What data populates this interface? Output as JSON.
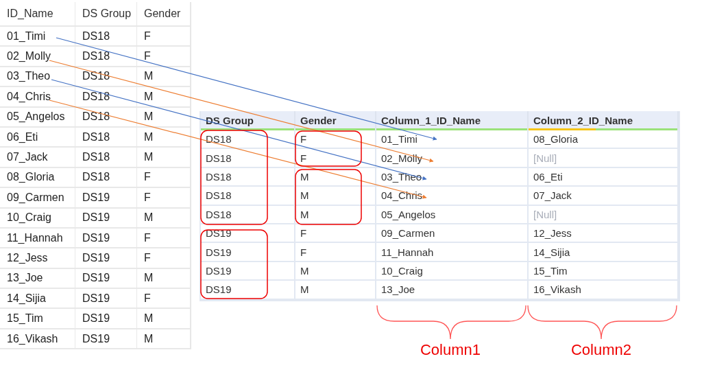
{
  "left_table": {
    "columns": [
      "ID_Name",
      "DS Group",
      "Gender"
    ],
    "rows": [
      [
        "01_Timi",
        "DS18",
        "F"
      ],
      [
        "02_Molly",
        "DS18",
        "F"
      ],
      [
        "03_Theo",
        "DS18",
        "M"
      ],
      [
        "04_Chris",
        "DS18",
        "M"
      ],
      [
        "05_Angelos",
        "DS18",
        "M"
      ],
      [
        "06_Eti",
        "DS18",
        "M"
      ],
      [
        "07_Jack",
        "DS18",
        "M"
      ],
      [
        "08_Gloria",
        "DS18",
        "F"
      ],
      [
        "09_Carmen",
        "DS19",
        "F"
      ],
      [
        "10_Craig",
        "DS19",
        "M"
      ],
      [
        "11_Hannah",
        "DS19",
        "F"
      ],
      [
        "12_Jess",
        "DS19",
        "F"
      ],
      [
        "13_Joe",
        "DS19",
        "M"
      ],
      [
        "14_Sijia",
        "DS19",
        "F"
      ],
      [
        "15_Tim",
        "DS19",
        "M"
      ],
      [
        "16_Vikash",
        "DS19",
        "M"
      ]
    ]
  },
  "right_table": {
    "columns": [
      {
        "label": "DS Group",
        "color": "#9be27a"
      },
      {
        "label": "Gender",
        "color": "#9be27a"
      },
      {
        "label": "Column_1_ID_Name",
        "color": "#9be27a"
      },
      {
        "label": "Column_2_ID_Name",
        "color": "#f5c518"
      }
    ],
    "rows": [
      {
        "cells": [
          "DS18",
          "F",
          "01_Timi",
          "08_Gloria"
        ],
        "null_column_2": false
      },
      {
        "cells": [
          "DS18",
          "F",
          "02_Molly",
          "[Null]"
        ],
        "null_column_2": true
      },
      {
        "cells": [
          "DS18",
          "M",
          "03_Theo",
          "06_Eti"
        ],
        "null_column_2": false
      },
      {
        "cells": [
          "DS18",
          "M",
          "04_Chris",
          "07_Jack"
        ],
        "null_column_2": false
      },
      {
        "cells": [
          "DS18",
          "M",
          "05_Angelos",
          "[Null]"
        ],
        "null_column_2": true
      },
      {
        "cells": [
          "DS19",
          "F",
          "09_Carmen",
          "12_Jess"
        ],
        "null_column_2": false
      },
      {
        "cells": [
          "DS19",
          "F",
          "11_Hannah",
          "14_Sijia"
        ],
        "null_column_2": false
      },
      {
        "cells": [
          "DS19",
          "M",
          "10_Craig",
          "15_Tim"
        ],
        "null_column_2": false
      },
      {
        "cells": [
          "DS19",
          "M",
          "13_Joe",
          "16_Vikash"
        ],
        "null_column_2": false
      }
    ]
  },
  "brace_labels": [
    "Column1",
    "Column2"
  ]
}
